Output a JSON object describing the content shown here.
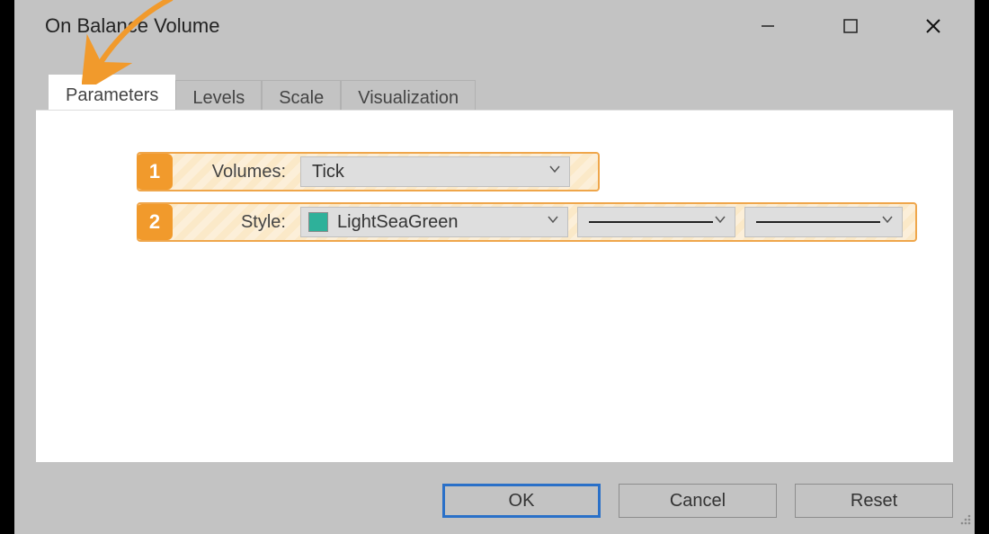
{
  "window": {
    "title": "On Balance Volume"
  },
  "tabs": {
    "parameters": "Parameters",
    "levels": "Levels",
    "scale": "Scale",
    "visualization": "Visualization",
    "active": "parameters"
  },
  "markers": {
    "one": "1",
    "two": "2"
  },
  "labels": {
    "volumes": "Volumes:",
    "style": "Style:"
  },
  "fields": {
    "volumes_value": "Tick",
    "color_value": "LightSeaGreen",
    "color_swatch_hex": "#2eb19a"
  },
  "buttons": {
    "ok": "OK",
    "cancel": "Cancel",
    "reset": "Reset"
  }
}
